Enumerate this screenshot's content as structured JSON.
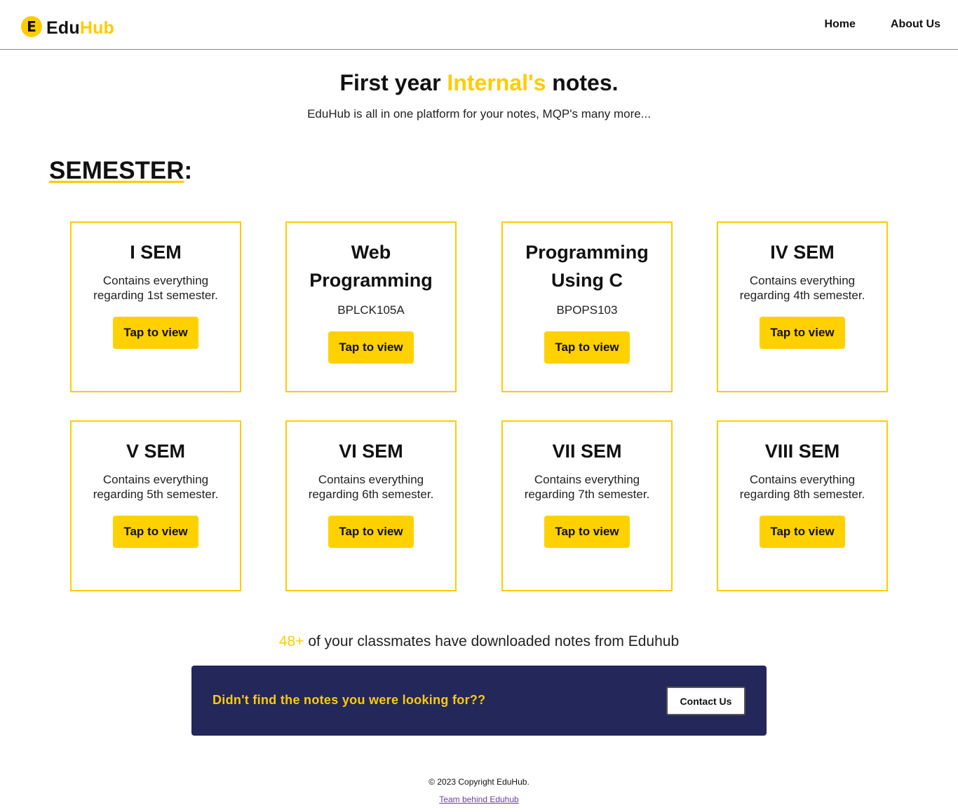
{
  "header": {
    "logo_letter": "E",
    "logo_part1": "Edu",
    "logo_part2": "Hub",
    "nav": [
      {
        "label": "Home"
      },
      {
        "label": "About Us"
      }
    ]
  },
  "hero": {
    "title_part1": "First year ",
    "title_accent": "Internal's",
    "title_part2": " notes.",
    "subtitle": "EduHub is all in one platform for your notes, MQP's many more..."
  },
  "section": {
    "heading": "SEMESTER",
    "heading_suffix": ":"
  },
  "cards": [
    {
      "title": "I SEM",
      "desc": "Contains everything regarding 1st semester.",
      "button": "Tap to view"
    },
    {
      "title": "Web Programming",
      "code": "BPLCK105A",
      "button": "Tap to view"
    },
    {
      "title": "Programming Using C",
      "code": "BPOPS103",
      "button": "Tap to view"
    },
    {
      "title": "IV SEM",
      "desc": "Contains everything regarding 4th semester.",
      "button": "Tap to view"
    },
    {
      "title": "V SEM",
      "desc": "Contains everything regarding 5th semester.",
      "button": "Tap to view"
    },
    {
      "title": "VI SEM",
      "desc": "Contains everything regarding 6th semester.",
      "button": "Tap to view"
    },
    {
      "title": "VII SEM",
      "desc": "Contains everything regarding 7th semester.",
      "button": "Tap to view"
    },
    {
      "title": "VIII SEM",
      "desc": "Contains everything regarding 8th semester.",
      "button": "Tap to view"
    }
  ],
  "stats": {
    "count": "48+",
    "text": " of your classmates have downloaded notes from Eduhub"
  },
  "banner": {
    "text": "Didn't find the notes you were looking for??",
    "button": "Contact Us"
  },
  "footer": {
    "copyright": "© 2023 Copyright EduHub.",
    "team_link": "Team behind Eduhub"
  },
  "colors": {
    "accent": "#ffcc00",
    "button": "#ffd100",
    "banner_bg": "#23275a",
    "link": "#6b3fa0"
  }
}
